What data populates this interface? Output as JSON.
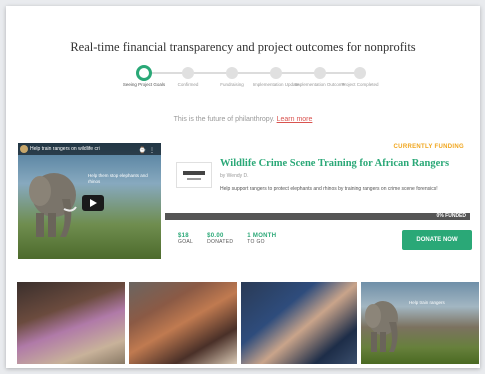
{
  "headline": "Real-time financial transparency and project outcomes for nonprofits",
  "steps": [
    {
      "label": "Seeing Project Goals",
      "active": true
    },
    {
      "label": "Confirmed",
      "active": false
    },
    {
      "label": "Fundraising",
      "active": false
    },
    {
      "label": "Implementation Update",
      "active": false
    },
    {
      "label": "Implementation Outcome",
      "active": false
    },
    {
      "label": "Project Completed",
      "active": false
    }
  ],
  "future_text": "This is the future of philanthropy.",
  "learn_more": "Learn more",
  "video": {
    "title": "Help train rangers on wildlife cri",
    "caption": "Help them stop elephants and rhinos"
  },
  "project": {
    "status": "CURRENTLY FUNDING",
    "title": "Wildlife Crime Scene Training for African Rangers",
    "by": "by Wendy D.",
    "description": "Help support rangers to protect elephants and rhinos by training rangers on crime scene forensics!",
    "funded_pct": 0,
    "funded_label": "0% FUNDED"
  },
  "stats": [
    {
      "value": "$18",
      "label": "GOAL"
    },
    {
      "value": "$0.00",
      "label": "DONATED"
    },
    {
      "value": "1 MONTH",
      "label": "TO GO"
    }
  ],
  "donate_label": "DONATE NOW",
  "photo_caption": "Help train rangers"
}
